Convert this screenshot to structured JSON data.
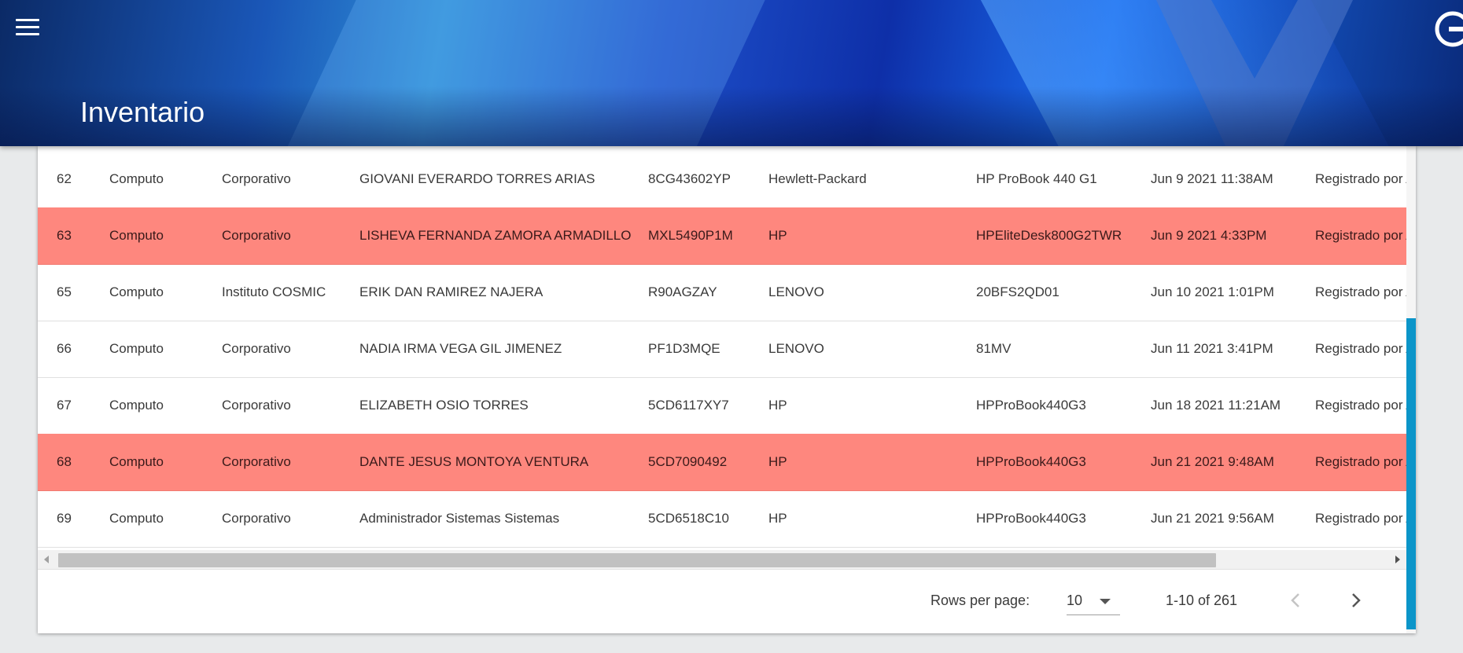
{
  "header": {
    "title": "Inventario"
  },
  "table": {
    "rows": [
      {
        "id": "62",
        "type": "Computo",
        "location": "Corporativo",
        "user": "GIOVANI EVERARDO TORRES ARIAS",
        "serial": "8CG43602YP",
        "brand": "Hewlett-Packard",
        "model": "HP ProBook 440 G1",
        "date": "Jun 9 2021 11:38AM",
        "note": "Registrado por A",
        "highlight": false
      },
      {
        "id": "63",
        "type": "Computo",
        "location": "Corporativo",
        "user": "LISHEVA FERNANDA ZAMORA ARMADILLO",
        "serial": "MXL5490P1M",
        "brand": "HP",
        "model": "HPEliteDesk800G2TWR",
        "date": "Jun 9 2021 4:33PM",
        "note": "Registrado por A",
        "highlight": true
      },
      {
        "id": "65",
        "type": "Computo",
        "location": "Instituto COSMIC",
        "user": "ERIK DAN RAMIREZ NAJERA",
        "serial": "R90AGZAY",
        "brand": "LENOVO",
        "model": "20BFS2QD01",
        "date": "Jun 10 2021 1:01PM",
        "note": "Registrado por A",
        "highlight": false
      },
      {
        "id": "66",
        "type": "Computo",
        "location": "Corporativo",
        "user": "NADIA IRMA VEGA GIL JIMENEZ",
        "serial": "PF1D3MQE",
        "brand": "LENOVO",
        "model": "81MV",
        "date": "Jun 11 2021 3:41PM",
        "note": "Registrado por A",
        "highlight": false
      },
      {
        "id": "67",
        "type": "Computo",
        "location": "Corporativo",
        "user": "ELIZABETH OSIO TORRES",
        "serial": "5CD6117XY7",
        "brand": "HP",
        "model": "HPProBook440G3",
        "date": "Jun 18 2021 11:21AM",
        "note": "Registrado por A",
        "highlight": false
      },
      {
        "id": "68",
        "type": "Computo",
        "location": "Corporativo",
        "user": "DANTE JESUS MONTOYA VENTURA",
        "serial": "5CD7090492",
        "brand": "HP",
        "model": "HPProBook440G3",
        "date": "Jun 21 2021 9:48AM",
        "note": "Registrado por A",
        "highlight": true
      },
      {
        "id": "69",
        "type": "Computo",
        "location": "Corporativo",
        "user": "Administrador Sistemas Sistemas",
        "serial": "5CD6518C10",
        "brand": "HP",
        "model": "HPProBook440G3",
        "date": "Jun 21 2021 9:56AM",
        "note": "Registrado por A",
        "highlight": false
      }
    ]
  },
  "pagination": {
    "rows_per_page_label": "Rows per page:",
    "rows_per_page_value": "10",
    "range": "1-10 of 261"
  },
  "colors": {
    "highlight_row": "#fe877e",
    "scrollbar_accent": "#0b95c9"
  },
  "icons": {
    "menu": "menu-icon",
    "logout": "logout-icon",
    "prev": "chevron-left-icon",
    "next": "chevron-right-icon",
    "caret": "caret-down-icon"
  }
}
